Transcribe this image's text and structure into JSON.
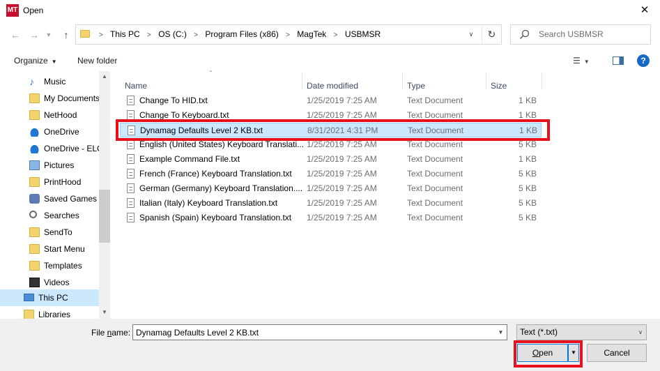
{
  "window": {
    "title": "Open",
    "app_icon_text": "MT",
    "close_glyph": "✕"
  },
  "address": {
    "crumbs": [
      "This PC",
      "OS (C:)",
      "Program Files (x86)",
      "MagTek",
      "USBMSR"
    ]
  },
  "search": {
    "placeholder": "Search USBMSR"
  },
  "toolbar": {
    "organize_label": "Organize",
    "new_folder_label": "New folder"
  },
  "nav": {
    "items": [
      {
        "label": "Music",
        "icon": "music-icon"
      },
      {
        "label": "My Documents",
        "icon": "folder-icon"
      },
      {
        "label": "NetHood",
        "icon": "folder-icon"
      },
      {
        "label": "OneDrive",
        "icon": "cloud-icon"
      },
      {
        "label": "OneDrive - ELC",
        "icon": "cloud-icon"
      },
      {
        "label": "Pictures",
        "icon": "pictures-icon"
      },
      {
        "label": "PrintHood",
        "icon": "folder-icon"
      },
      {
        "label": "Saved Games",
        "icon": "game-icon"
      },
      {
        "label": "Searches",
        "icon": "search-icon"
      },
      {
        "label": "SendTo",
        "icon": "folder-icon"
      },
      {
        "label": "Start Menu",
        "icon": "folder-icon"
      },
      {
        "label": "Templates",
        "icon": "folder-icon"
      },
      {
        "label": "Videos",
        "icon": "video-icon"
      },
      {
        "label": "This PC",
        "icon": "computer-icon"
      },
      {
        "label": "Libraries",
        "icon": "library-icon"
      }
    ]
  },
  "columns": {
    "name": "Name",
    "date": "Date modified",
    "type": "Type",
    "size": "Size"
  },
  "files": [
    {
      "name": "Change To HID.txt",
      "date": "1/25/2019 7:25 AM",
      "type": "Text Document",
      "size": "1 KB"
    },
    {
      "name": "Change To Keyboard.txt",
      "date": "1/25/2019 7:25 AM",
      "type": "Text Document",
      "size": "1 KB"
    },
    {
      "name": "Dynamag Defaults Level 2 KB.txt",
      "date": "8/31/2021 4:31 PM",
      "type": "Text Document",
      "size": "1 KB"
    },
    {
      "name": "English (United States) Keyboard Translati...",
      "date": "1/25/2019 7:25 AM",
      "type": "Text Document",
      "size": "5 KB"
    },
    {
      "name": "Example Command File.txt",
      "date": "1/25/2019 7:25 AM",
      "type": "Text Document",
      "size": "1 KB"
    },
    {
      "name": "French (France) Keyboard Translation.txt",
      "date": "1/25/2019 7:25 AM",
      "type": "Text Document",
      "size": "5 KB"
    },
    {
      "name": "German (Germany) Keyboard Translation....",
      "date": "1/25/2019 7:25 AM",
      "type": "Text Document",
      "size": "5 KB"
    },
    {
      "name": "Italian (Italy) Keyboard Translation.txt",
      "date": "1/25/2019 7:25 AM",
      "type": "Text Document",
      "size": "5 KB"
    },
    {
      "name": "Spanish (Spain) Keyboard Translation.txt",
      "date": "1/25/2019 7:25 AM",
      "type": "Text Document",
      "size": "5 KB"
    }
  ],
  "bottom": {
    "file_name_label_pre": "File ",
    "file_name_label_u": "n",
    "file_name_label_post": "ame:",
    "file_name_value": "Dynamag Defaults Level 2 KB.txt",
    "file_type_value": "Text (*.txt)",
    "open_label_u": "O",
    "open_label_post": "pen",
    "cancel_label": "Cancel"
  },
  "colors": {
    "highlight_border": "#e8101d",
    "selection_bg": "#cce8ff",
    "accent": "#0078d7"
  }
}
